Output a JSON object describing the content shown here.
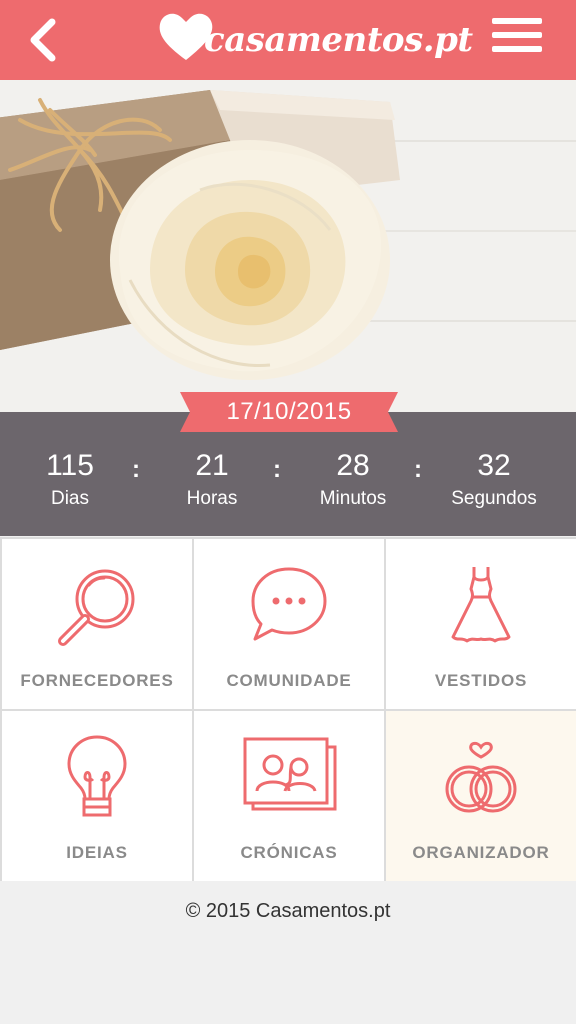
{
  "header": {
    "logo_text": "casamentos.pt",
    "back_label": "",
    "colors": {
      "bar": "#ee6b6e",
      "icon": "#ffffff"
    }
  },
  "hero": {
    "date": "17/10/2015"
  },
  "countdown": {
    "units": [
      {
        "value": "115",
        "label": "Dias"
      },
      {
        "value": "21",
        "label": "Horas"
      },
      {
        "value": "28",
        "label": "Minutos"
      },
      {
        "value": "32",
        "label": "Segundos"
      }
    ],
    "separator": ":"
  },
  "menu": {
    "tiles": [
      {
        "label": "FORNECEDORES",
        "icon": "magnifier-icon"
      },
      {
        "label": "COMUNIDADE",
        "icon": "chat-bubble-icon"
      },
      {
        "label": "VESTIDOS",
        "icon": "dress-icon"
      },
      {
        "label": "IDEIAS",
        "icon": "lightbulb-icon"
      },
      {
        "label": "CRÓNICAS",
        "icon": "photo-album-icon"
      },
      {
        "label": "ORGANIZADOR",
        "icon": "rings-icon"
      }
    ],
    "accent": "#ee6b6e"
  },
  "footer": {
    "copyright": "© 2015 Casamentos.pt"
  }
}
